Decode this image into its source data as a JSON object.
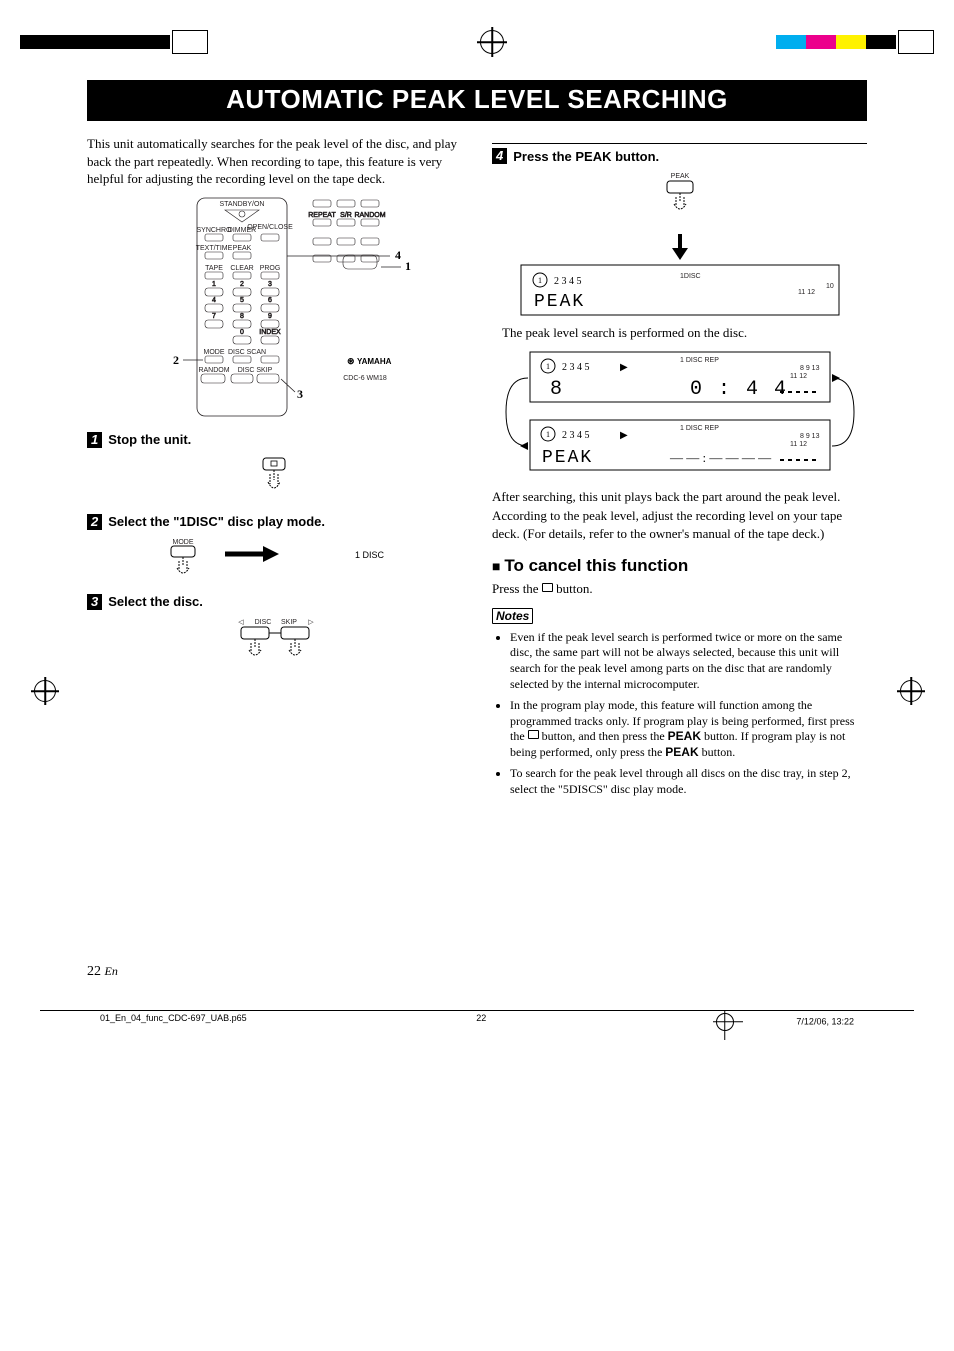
{
  "title": "AUTOMATIC PEAK LEVEL SEARCHING",
  "intro": "This unit automatically searches for the peak level of the disc, and play back the part repeatedly. When recording to tape, this feature is very helpful for adjusting the recording level on the tape deck.",
  "callouts": {
    "c1": "1",
    "c2": "2",
    "c3": "3",
    "c4": "4"
  },
  "steps": {
    "s1": {
      "num": "1",
      "text": "Stop the unit."
    },
    "s2": {
      "num": "2",
      "text": "Select the \"1DISC\" disc play mode."
    },
    "s3": {
      "num": "3",
      "text": "Select the disc."
    },
    "s4": {
      "num": "4",
      "text": "Press the PEAK button."
    }
  },
  "remote_labels": {
    "standby_on": "STANDBY/ON",
    "synchro": "SYNCHRO",
    "dimmer": "DIMMER",
    "open_close": "OPEN/CLOSE",
    "text_time": "TEXT/TIME",
    "peak": "PEAK",
    "tape": "TAPE",
    "clear": "CLEAR",
    "prog": "PROG",
    "index": "INDEX",
    "mode": "MODE",
    "disc_scan_left": "DISC SCAN",
    "random": "RANDOM",
    "disc_skip": "DISC SKIP",
    "repeat": "REPEAT",
    "sr": "S/R",
    "random_top": "RANDOM",
    "yamaha": "YAMAHA",
    "model": "CDC-6  WM18"
  },
  "step2": {
    "mode_label": "MODE",
    "display": "1 DISC"
  },
  "step3": {
    "skip_left": "DISC",
    "skip_right": "SKIP"
  },
  "step4": {
    "peak_label": "PEAK",
    "display1": {
      "discs": "2  3  4  5",
      "mode": "1DISC",
      "main": "PEAK",
      "bars_right": "10",
      "bars_nums": "11 12"
    },
    "caption": "The peak level search is performed on the disc.",
    "display2": {
      "discs": "2  3  4  5",
      "mode": "1 DISC REP",
      "track": "8",
      "time": "0 : 4 4",
      "bars_nums": "11 12",
      "bars_top": "8  9 13"
    },
    "display3": {
      "discs": "2  3  4  5",
      "mode": "1 DISC REP",
      "main": "PEAK",
      "time_dashes": "— — : — —  — —",
      "bars_nums": "11 12",
      "bars_top": "8  9 13"
    },
    "after1": "After searching, this unit plays back the part around the peak level.",
    "after2": "According to the peak level, adjust the recording level on your tape deck. (For details, refer to the owner's manual of the tape deck.)"
  },
  "cancel": {
    "heading": "To cancel this function",
    "body_pre": "Press the ",
    "body_post": " button."
  },
  "notes_title": "Notes",
  "notes": [
    "Even if the peak level search is performed twice or more on the same disc, the same part will not be always selected, because this unit will search for the peak level among parts on the disc that are randomly selected by the internal microcomputer.",
    {
      "pre": "In the program play mode, this feature will function among the programmed tracks only. If program play is being performed, first press the ",
      "mid": " button, and then press the ",
      "bold1": "PEAK",
      "post1": " button. If program play is not being performed, only press the ",
      "bold2": "PEAK",
      "post2": " button."
    },
    "To search for the peak level through all discs on the disc tray, in step 2, select the \"5DISCS\" disc play mode."
  ],
  "page_number": "22",
  "page_lang": "En",
  "footer": {
    "file": "01_En_04_func_CDC-697_UAB.p65",
    "page": "22",
    "datetime": "7/12/06, 13:22"
  }
}
